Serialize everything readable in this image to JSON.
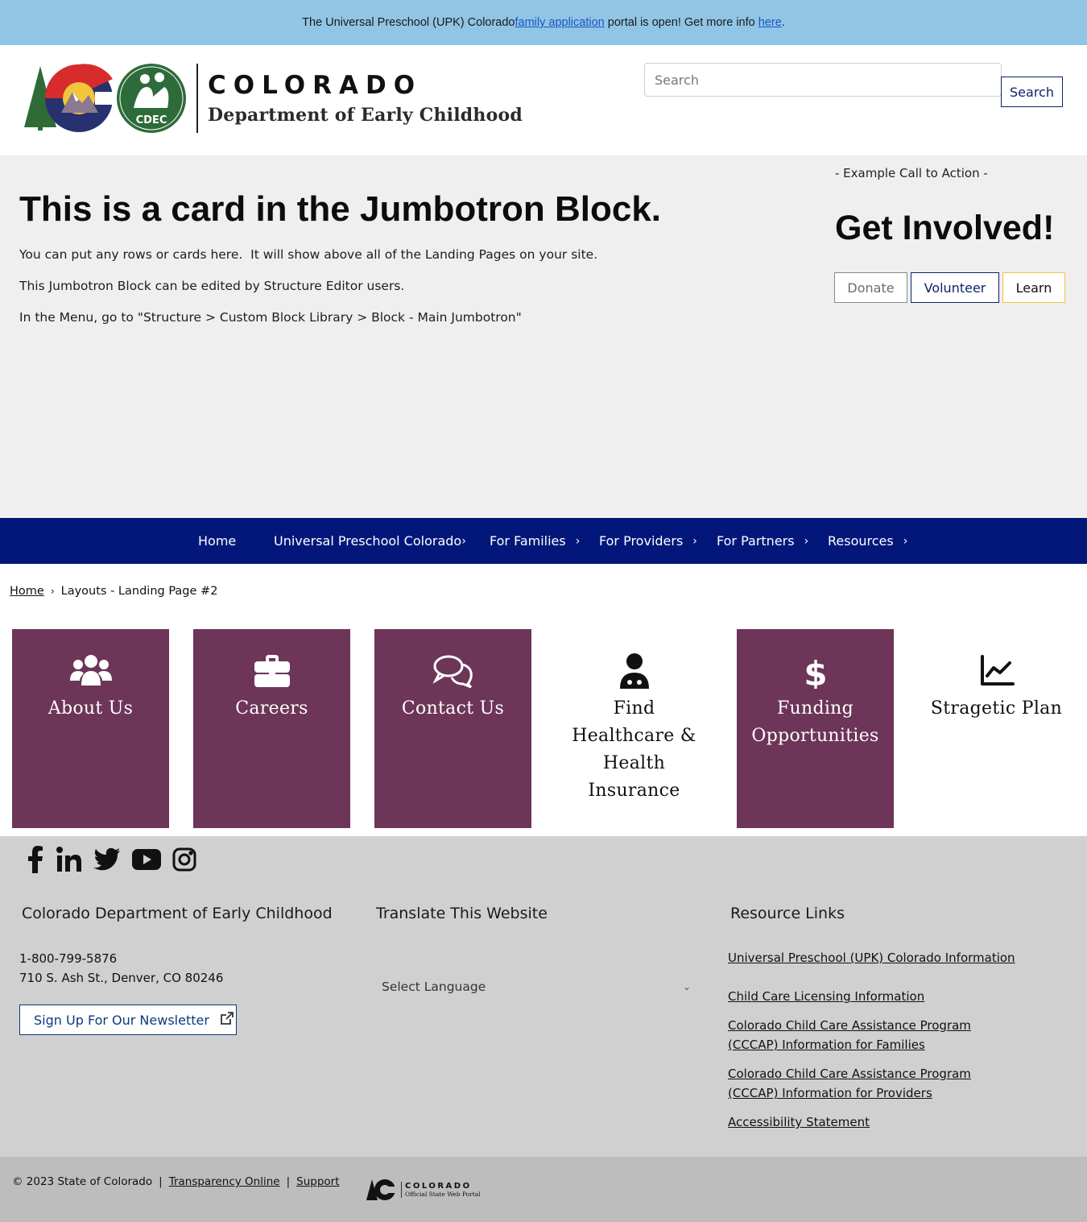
{
  "alert": {
    "prefix": "The Universal Preschool (UPK) Colorado ",
    "link1": "family application",
    "middle": " portal is open! Get more info ",
    "link2": "here",
    "suffix": "."
  },
  "header": {
    "logo_colorado": "COLORADO",
    "logo_dept": "Department of Early Childhood",
    "logo_badge": "CDEC",
    "search_placeholder": "Search",
    "search_button": "Search"
  },
  "jumbotron": {
    "heading": "This is a card in the Jumbotron Block.",
    "p1": "You can put any rows or cards here.  It will show above all of the Landing Pages on your site.",
    "p2": "This Jumbotron Block can be edited by Structure Editor users.",
    "p3": "In the Menu, go to \"Structure > Custom Block Library > Block - Main Jumbotron\"",
    "cta_small": "- Example Call to Action -",
    "cta_title": "Get Involved!",
    "buttons": [
      "Donate",
      "Volunteer",
      "Learn"
    ]
  },
  "nav": {
    "items": [
      "Home",
      "Universal Preschool Colorado",
      "For Families",
      "For Providers",
      "For Partners",
      "Resources"
    ]
  },
  "breadcrumb": {
    "home": "Home",
    "current": "Layouts - Landing Page #2"
  },
  "tiles": [
    {
      "label": "About Us",
      "icon": "users-icon"
    },
    {
      "label": "Careers",
      "icon": "briefcase-icon"
    },
    {
      "label": "Contact Us",
      "icon": "comments-icon"
    },
    {
      "label": "Find Healthcare & Health Insurance",
      "icon": "doctor-icon"
    },
    {
      "label": "Funding Opportunities",
      "icon": "dollar-icon"
    },
    {
      "label": "Stragetic Plan",
      "icon": "chart-line-icon"
    }
  ],
  "colors": {
    "nav_bg": "#03177b",
    "tile_purple": "#6d3558",
    "alert_bg": "#91c5e6",
    "footer_bg": "#d0d0d0"
  },
  "footer": {
    "social": [
      "facebook-icon",
      "linkedin-icon",
      "twitter-icon",
      "youtube-icon",
      "instagram-icon"
    ],
    "col1_heading": "Colorado Department of Early Childhood",
    "phone": "1-800-799-5876",
    "address": "710 S. Ash St., Denver, CO 80246",
    "newsletter": "Sign Up For Our Newsletter",
    "col2_heading": "Translate This Website",
    "language_select": "Select Language",
    "col3_heading": "Resource Links",
    "links": [
      "Universal Preschool (UPK) Colorado Information",
      "Child Care Licensing Information",
      "Colorado Child Care Assistance Program (CCCAP) Information for Families",
      "Colorado Child Care Assistance Program (CCCAP) Information for Providers",
      "Accessibility Statement"
    ]
  },
  "bottom": {
    "copyright": "© 2023 State of Colorado",
    "transparency": "Transparency Online",
    "support": "Support",
    "portal_colorado": "COLORADO",
    "portal_sub": "Official State Web Portal"
  }
}
